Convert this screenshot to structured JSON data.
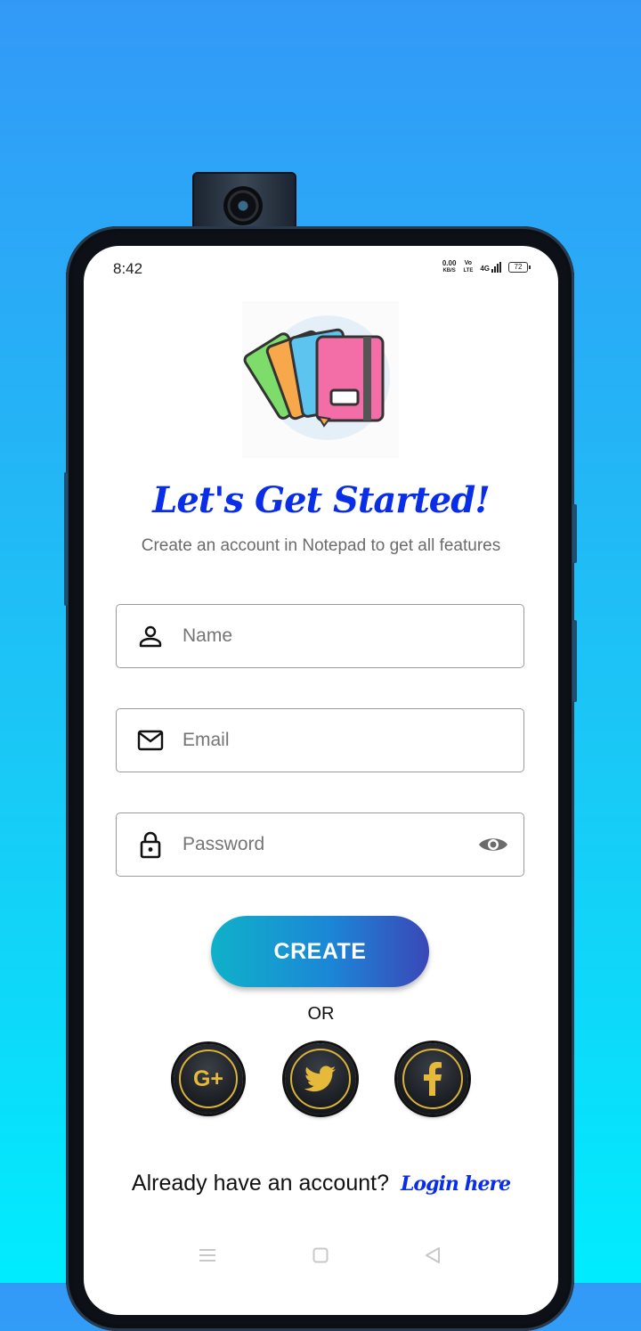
{
  "status_bar": {
    "time": "8:42",
    "net_speed_value": "0.00",
    "net_speed_unit": "KB/S",
    "volte_top": "Vo",
    "volte_bottom": "LTE",
    "network": "4G",
    "battery": "72"
  },
  "header": {
    "title": "Let's Get Started!",
    "subtitle": "Create an account in Notepad to get all features"
  },
  "form": {
    "name": {
      "placeholder": "Name",
      "value": "",
      "icon": "person-icon"
    },
    "email": {
      "placeholder": "Email",
      "value": "",
      "icon": "mail-icon"
    },
    "password": {
      "placeholder": "Password",
      "value": "",
      "icon": "lock-icon",
      "toggle_icon": "eye-icon"
    }
  },
  "actions": {
    "create_label": "CREATE",
    "or_label": "OR"
  },
  "social": {
    "google_label": "G+",
    "items": [
      "google-plus-icon",
      "twitter-icon",
      "facebook-icon"
    ]
  },
  "footer": {
    "prompt": "Already have an account?",
    "login_label": "Login here"
  },
  "nav": {
    "items": [
      "menu-icon",
      "home-icon",
      "back-icon"
    ]
  },
  "colors": {
    "accent": "#0a2ee8",
    "button_start": "#0fb1c9",
    "button_end": "#3a48b7",
    "background_top": "#3399f7",
    "background_bottom": "#00ecfe",
    "social_ring": "#d9b23a"
  }
}
